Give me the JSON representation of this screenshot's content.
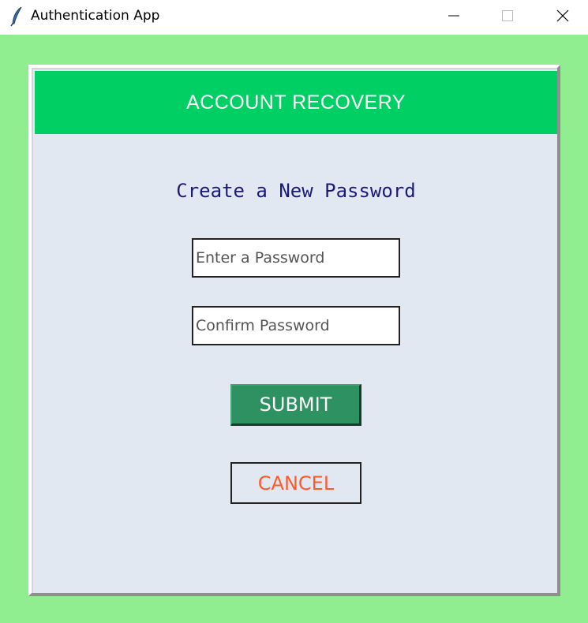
{
  "window": {
    "title": "Authentication App",
    "icon": "feather-icon",
    "controls": [
      "minimize-icon",
      "maximize-icon",
      "close-icon"
    ]
  },
  "header": {
    "title": "ACCOUNT RECOVERY"
  },
  "form": {
    "subtitle": "Create a New Password",
    "password_placeholder": "Enter a Password",
    "confirm_placeholder": "Confirm Password",
    "password_value": "",
    "confirm_value": "",
    "submit_label": "SUBMIT",
    "cancel_label": "CANCEL"
  },
  "colors": {
    "background": "#90ee90",
    "header": "#00cf64",
    "panel": "#e1e8f2",
    "submit": "#2e9161",
    "cancel_text": "#ff5a2a",
    "subtitle_text": "#1a1a7a"
  }
}
